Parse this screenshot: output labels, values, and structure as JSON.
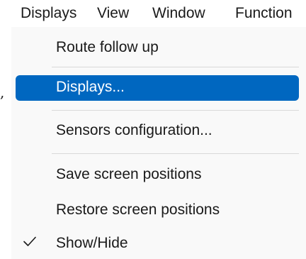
{
  "menubar": {
    "items": [
      "Displays",
      "View",
      "Window",
      "Function"
    ]
  },
  "dropdown": {
    "items": [
      {
        "label": "Route follow up",
        "selected": false,
        "checked": false
      },
      {
        "label": "Displays...",
        "selected": true,
        "checked": false
      },
      {
        "label": "Sensors configuration...",
        "selected": false,
        "checked": false
      },
      {
        "label": "Save screen positions",
        "selected": false,
        "checked": false
      },
      {
        "label": "Restore screen positions",
        "selected": false,
        "checked": false
      },
      {
        "label": "Show/Hide",
        "selected": false,
        "checked": true
      }
    ]
  },
  "stray_glyph": ",",
  "colors": {
    "selection": "#0067c0",
    "menu_bg": "#f9f9f9",
    "separator": "#d9d9d9"
  },
  "icons": {
    "checkmark": "checkmark-icon"
  }
}
